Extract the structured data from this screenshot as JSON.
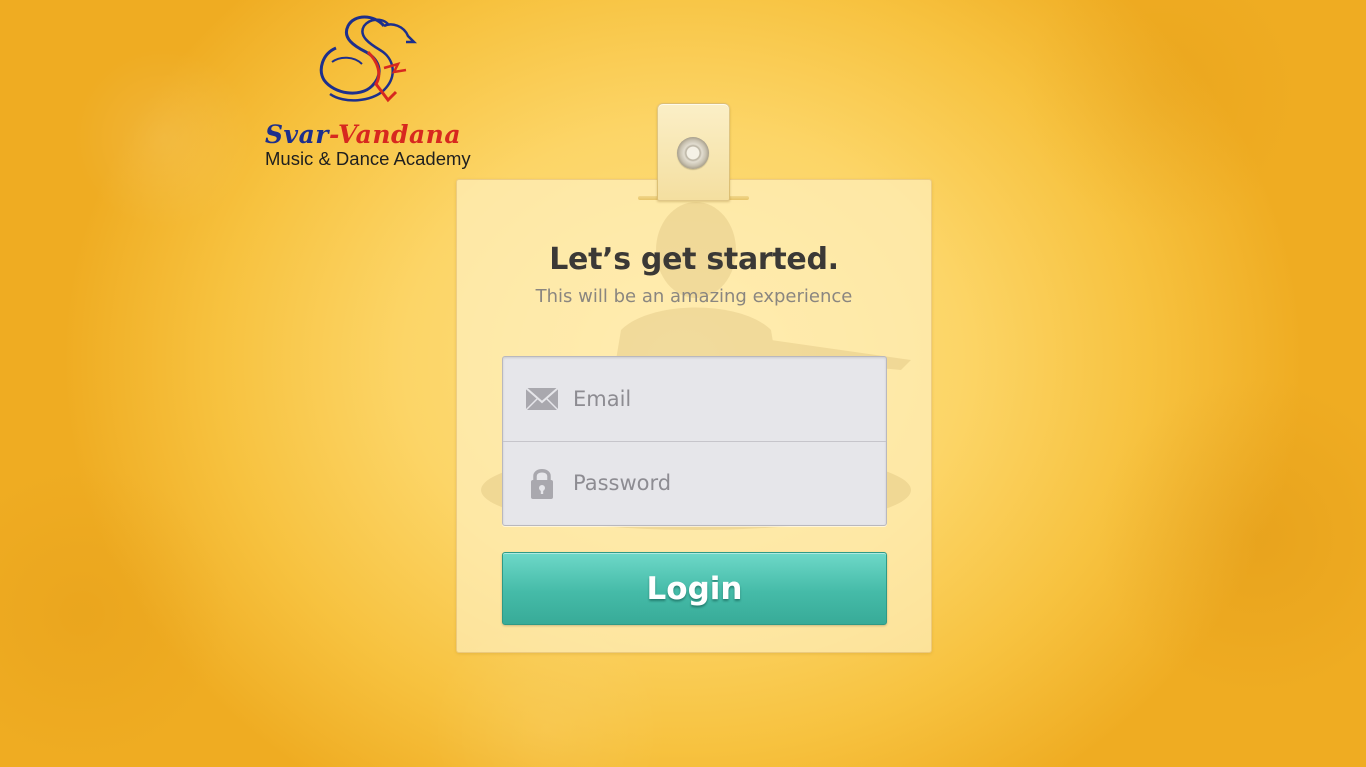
{
  "logo": {
    "name_part1": "Svar",
    "separator": "-",
    "name_part2": "Vandana",
    "tagline": "Music & Dance Academy"
  },
  "login_card": {
    "title": "Let’s get started.",
    "subtitle": "This will be an amazing experience",
    "email": {
      "placeholder": "Email",
      "value": "",
      "icon": "envelope-icon"
    },
    "password": {
      "placeholder": "Password",
      "value": "",
      "icon": "lock-icon"
    },
    "login_label": "Login"
  },
  "colors": {
    "background": "#f9c84a",
    "logo_blue": "#1d2f8c",
    "logo_red": "#d7281f",
    "button_teal": "#45bba8",
    "title_text": "#3b3936"
  }
}
